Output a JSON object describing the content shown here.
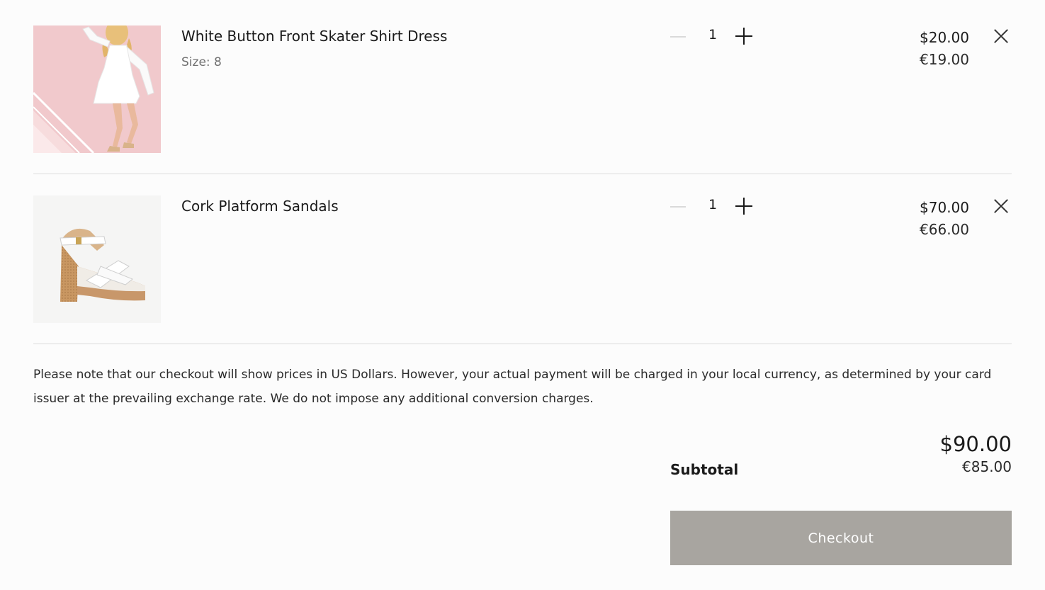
{
  "cart": {
    "items": [
      {
        "title": "White Button Front Skater Shirt Dress",
        "variant": "Size: 8",
        "quantity": "1",
        "price_primary": "$20.00",
        "price_secondary": "€19.00",
        "image_icon": "white-dress-photo"
      },
      {
        "title": "Cork Platform Sandals",
        "variant": "",
        "quantity": "1",
        "price_primary": "$70.00",
        "price_secondary": "€66.00",
        "image_icon": "sandal-photo"
      }
    ],
    "notice": "Please note that our checkout will show prices in US Dollars. However, your actual payment will be charged in your local currency, as determined by your card issuer at the prevailing exchange rate. We do not impose any additional conversion charges.",
    "subtotal": {
      "label": "Subtotal",
      "primary": "$90.00",
      "secondary": "€85.00"
    },
    "checkout_label": "Checkout"
  },
  "colors": {
    "background": "#fcfcfc",
    "checkout_button": "#a8a5a0",
    "divider": "#dcdcdc"
  }
}
